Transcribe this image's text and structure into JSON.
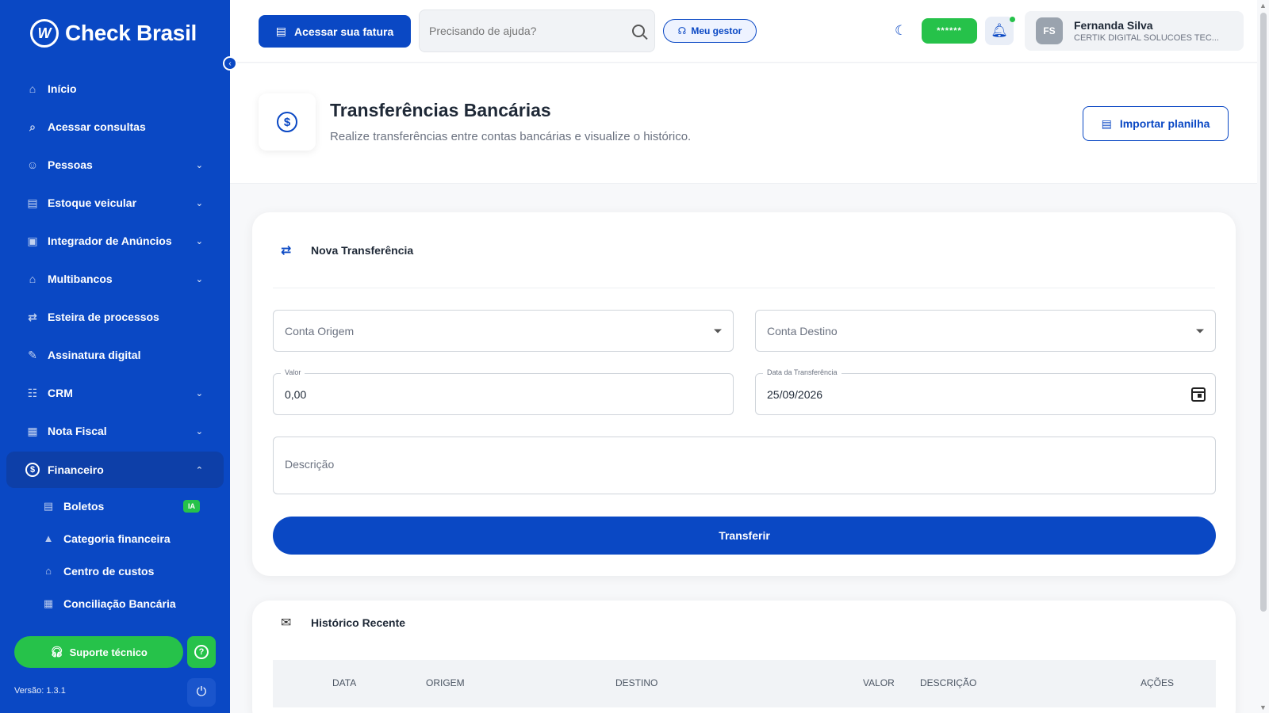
{
  "sidebar": {
    "brand_mark": "W",
    "brand_name": "Check Brasil",
    "items": [
      {
        "label": "Início",
        "icon": "home-icon",
        "glyph": "⌂"
      },
      {
        "label": "Acessar consultas",
        "icon": "search-icon",
        "glyph": "⌕"
      },
      {
        "label": "Pessoas",
        "icon": "people-icon",
        "glyph": "☺",
        "chevron": "⌄"
      },
      {
        "label": "Estoque veicular",
        "icon": "car-icon",
        "glyph": "▤",
        "chevron": "⌄"
      },
      {
        "label": "Integrador de Anúncios",
        "icon": "ads-icon",
        "glyph": "▣",
        "chevron": "⌄"
      },
      {
        "label": "Multibancos",
        "icon": "bank-icon",
        "glyph": "⌂",
        "chevron": "⌄"
      },
      {
        "label": "Esteira de processos",
        "icon": "workflow-icon",
        "glyph": "⇄"
      },
      {
        "label": "Assinatura digital",
        "icon": "signature-icon",
        "glyph": "✎"
      },
      {
        "label": "CRM",
        "icon": "crm-icon",
        "glyph": "☷",
        "chevron": "⌄"
      },
      {
        "label": "Nota Fiscal",
        "icon": "invoice-icon",
        "glyph": "▦",
        "chevron": "⌄"
      }
    ],
    "active_item": {
      "label": "Financeiro",
      "icon": "finance-icon",
      "glyph": "$",
      "chevron": "⌃"
    },
    "sub_items": [
      {
        "label": "Boletos",
        "icon": "boleto-icon",
        "glyph": "▤",
        "badge": "IA"
      },
      {
        "label": "Categoria financeira",
        "icon": "category-icon",
        "glyph": "▲"
      },
      {
        "label": "Centro de custos",
        "icon": "bank-icon",
        "glyph": "⌂"
      },
      {
        "label": "Conciliação Bancária",
        "icon": "reconcile-icon",
        "glyph": "▦"
      }
    ],
    "support_label": "Suporte técnico",
    "help_glyph": "?",
    "version": "Versão: 1.3.1",
    "power_glyph": "⏻"
  },
  "topbar": {
    "invoice_label": "Acessar sua fatura",
    "search_placeholder": "Precisando de ajuda?",
    "gestor_label": "Meu gestor",
    "balance_masked": "******",
    "user": {
      "initials": "FS",
      "name": "Fernanda Silva",
      "company": "CERTIK DIGITAL SOLUCOES TEC..."
    }
  },
  "page": {
    "title": "Transferências Bancárias",
    "subtitle": "Realize transferências entre contas bancárias e visualize o histórico.",
    "header_glyph": "$",
    "import_label": "Importar planilha"
  },
  "form": {
    "heading": "Nova Transferência",
    "origem_placeholder": "Conta Origem",
    "destino_placeholder": "Conta Destino",
    "valor_label": "Valor",
    "valor_value": "0,00",
    "data_label": "Data da Transferência",
    "data_value": "25/09/2026",
    "descricao_placeholder": "Descrição",
    "submit_label": "Transferir"
  },
  "history": {
    "heading": "Histórico Recente",
    "columns": [
      "DATA",
      "ORIGEM",
      "DESTINO",
      "VALOR",
      "DESCRIÇÃO",
      "AÇÕES"
    ]
  },
  "colors": {
    "primary": "#0a48c4",
    "success": "#26c24a",
    "background": "#f7f8fa"
  }
}
